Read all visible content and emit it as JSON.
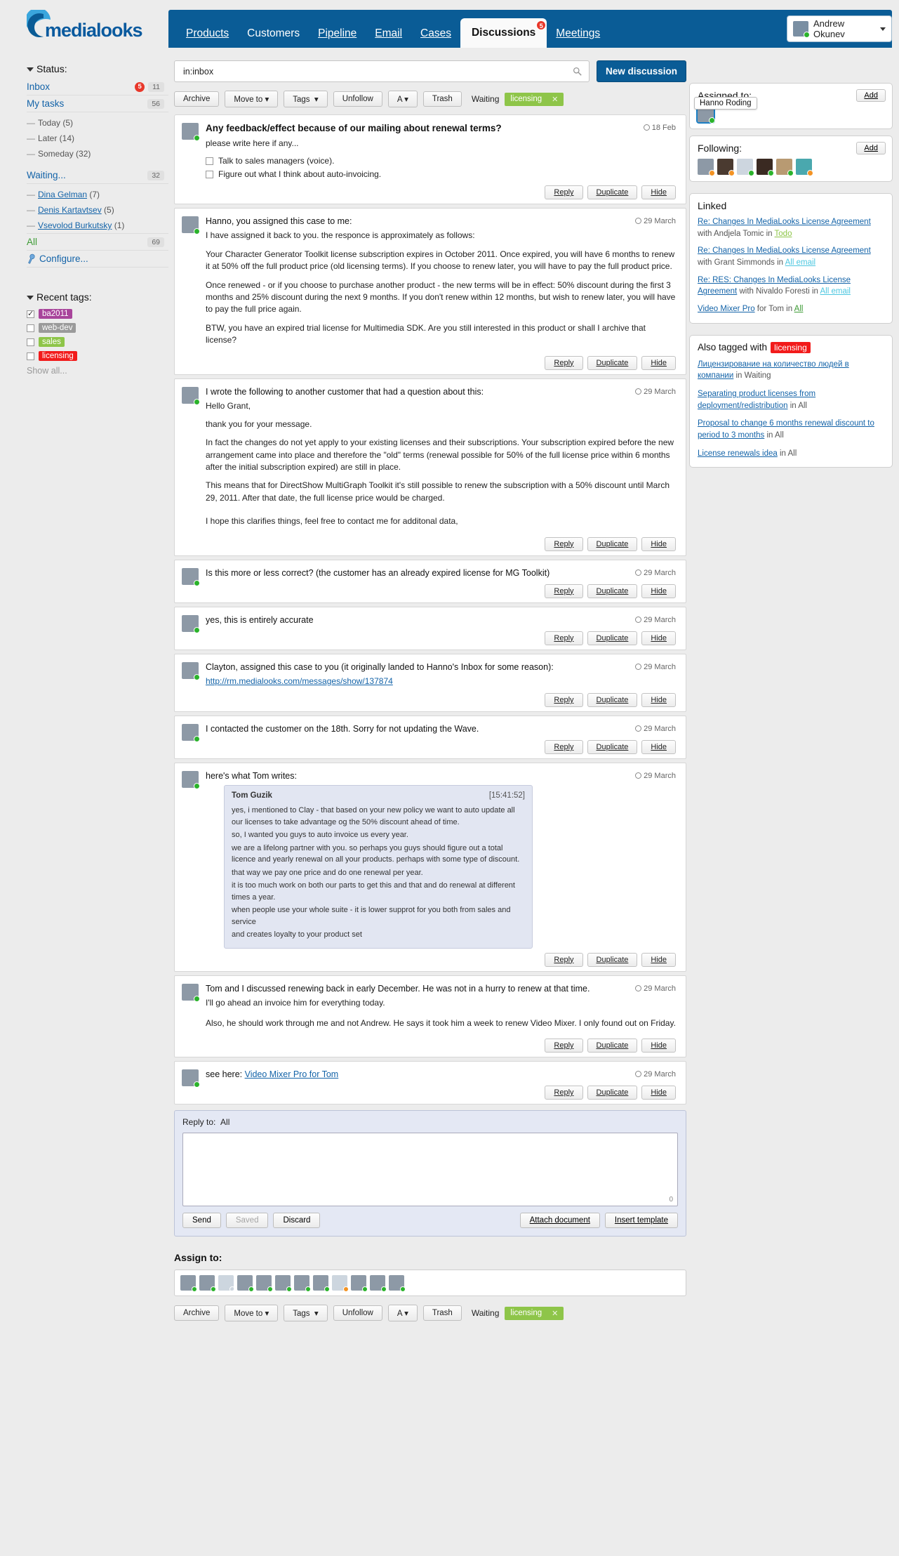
{
  "brand": {
    "name": "medialooks",
    "accent": "#0a5c96"
  },
  "nav": {
    "items": [
      {
        "label": "Products",
        "active": false,
        "badge": null
      },
      {
        "label": "Customers",
        "active": false,
        "badge": null
      },
      {
        "label": "Pipeline",
        "active": false,
        "badge": null
      },
      {
        "label": "Email",
        "active": false,
        "badge": null
      },
      {
        "label": "Cases",
        "active": false,
        "badge": null
      },
      {
        "label": "Discussions",
        "active": true,
        "badge": "5"
      },
      {
        "label": "Meetings",
        "active": false,
        "badge": null
      }
    ]
  },
  "user": {
    "name": "Andrew Okunev"
  },
  "sidebar": {
    "status_header": "Status:",
    "status_items": [
      {
        "label": "Inbox",
        "red": "5",
        "count": "11"
      },
      {
        "label": "My tasks",
        "red": null,
        "count": "56"
      }
    ],
    "task_subitems": [
      {
        "label": "Today (5)"
      },
      {
        "label": "Later (14)"
      },
      {
        "label": "Someday (32)"
      }
    ],
    "waiting": {
      "label": "Waiting...",
      "count": "32"
    },
    "waiting_subitems": [
      {
        "name": "Dina Gelman",
        "count": "(7)"
      },
      {
        "name": "Denis Kartavtsev",
        "count": "(5)"
      },
      {
        "name": "Vsevolod Burkutsky",
        "count": "(1)"
      }
    ],
    "all": {
      "label": "All",
      "count": "69"
    },
    "configure": "Configure...",
    "tags_header": "Recent tags:",
    "tags": [
      {
        "label": "ba2011",
        "color": "#a8449b",
        "checked": true
      },
      {
        "label": "web-dev",
        "color": "#9a9a9a",
        "checked": false
      },
      {
        "label": "sales",
        "color": "#8ec549",
        "checked": false
      },
      {
        "label": "licensing",
        "color": "#f21b1b",
        "checked": false
      }
    ],
    "show_all": "Show all..."
  },
  "search": {
    "value": "in:inbox",
    "placeholder": "Search",
    "new_button": "New discussion"
  },
  "toolbar": {
    "buttons": [
      "Archive",
      "Move to",
      "Tags",
      "Unfollow",
      "A",
      "Trash"
    ],
    "dropdowns": [
      "Move to",
      "Tags",
      "A"
    ],
    "waiting_label": "Waiting",
    "chip": {
      "label": "licensing",
      "color": "#8ec549"
    }
  },
  "messages": [
    {
      "id": "m1",
      "title": "Any feedback/effect because of our mailing about renewal terms?",
      "date": "18 Feb",
      "avatar_status": "on",
      "paras": [
        "please write here if any..."
      ],
      "checkboxes": [
        "Talk to sales managers (voice).",
        "Figure out what I think about auto-invoicing."
      ],
      "actions": [
        "Reply",
        "Duplicate",
        "Hide"
      ]
    },
    {
      "id": "m2",
      "head": "Hanno, you assigned this case to me:",
      "date": "29 March",
      "avatar_status": "on",
      "paras": [
        "I have assigned it back to you. the responce is approximately as follows:",
        "Your Character Generator Toolkit license subscription expires in October 2011. Once expired, you will have 6 months to renew it at 50% off the full product price (old licensing terms). If you choose to renew later, you will have to pay the full product price.",
        "Once renewed - or if you choose to purchase another product - the new terms will be in effect: 50% discount during the first 3 months and 25% discount during the next 9 months. If you don't renew within 12 months, but wish to renew later, you will have to pay the full price again.",
        "BTW, you have an expired trial license for Multimedia SDK. Are you still interested in this product or shall I archive that license?"
      ],
      "actions": [
        "Reply",
        "Duplicate",
        "Hide"
      ]
    },
    {
      "id": "m3",
      "head": "I wrote the following to another customer that had a question about this:",
      "date": "29 March",
      "avatar_status": "on",
      "paras": [
        "Hello Grant,",
        "thank you for your message.",
        "In fact the changes do not yet apply to your existing licenses and their subscriptions. Your subscription expired before the new arrangement came into place and therefore the \"old\" terms (renewal possible for 50% of the full license price within 6 months after the initial subscription expired) are still in place.",
        "This means that for DirectShow MultiGraph Toolkit it's still possible to renew the subscription with a 50% discount until March 29, 2011. After that date, the full license price would be charged.",
        "I hope this clarifies things, feel free to contact me for additonal data,"
      ],
      "actions": [
        "Reply",
        "Duplicate",
        "Hide"
      ]
    },
    {
      "id": "m4",
      "head": "Is this more or less correct? (the customer has an already expired license for MG Toolkit)",
      "date": "29 March",
      "avatar_status": "on",
      "paras": [],
      "actions": [
        "Reply",
        "Duplicate",
        "Hide"
      ]
    },
    {
      "id": "m5",
      "head": "yes, this is entirely accurate",
      "date": "29 March",
      "avatar_status": "on",
      "paras": [],
      "actions": [
        "Reply",
        "Duplicate",
        "Hide"
      ]
    },
    {
      "id": "m6",
      "head": "Clayton, assigned this case to you (it originally landed to Hanno's Inbox for some reason):",
      "date": "29 March",
      "avatar_status": "on",
      "link": "http://rm.medialooks.com/messages/show/137874",
      "paras": [],
      "actions": [
        "Reply",
        "Duplicate",
        "Hide"
      ]
    },
    {
      "id": "m7",
      "head": "I contacted the customer on the 18th.  Sorry for not updating the Wave.",
      "date": "29 March",
      "avatar_status": "on",
      "paras": [],
      "actions": [
        "Reply",
        "Duplicate",
        "Hide"
      ]
    },
    {
      "id": "m8",
      "head": "here's what Tom writes:",
      "date": "29 March",
      "avatar_status": "on",
      "quote": {
        "author": "Tom Guzik",
        "time": "[15:41:52]",
        "lines": [
          "yes, i mentioned to Clay - that based on your new policy we want to auto update all our licenses to take advantage og the 50% discount ahead of time.",
          "so, I wanted you guys to auto invoice us every year.",
          "we are a lifelong partner with you. so perhaps you guys should figure out a total licence and yearly renewal on all your products. perhaps with some type of discount.",
          "that way we pay one price and do one renewal per year.",
          "it is too much work on both our parts to get this and that and do renewal at different times a year.",
          "when people use your whole suite - it is lower supprot for you both from sales and service",
          "and creates loyalty to your product set"
        ]
      },
      "paras": [],
      "actions": [
        "Reply",
        "Duplicate",
        "Hide"
      ]
    },
    {
      "id": "m9",
      "head": "Tom and I discussed renewing back in early December.  He was not in a hurry to renew at that time.",
      "date": "29 March",
      "avatar_status": "on",
      "paras": [
        "I'll go ahead an invoice him for everything today.",
        "Also, he should work through me and not Andrew.  He says it took him a week to renew Video Mixer. I only found out on Friday."
      ],
      "actions": [
        "Reply",
        "Duplicate",
        "Hide"
      ]
    },
    {
      "id": "m10",
      "head_prefix": "see here: ",
      "head_link": "Video Mixer Pro for Tom",
      "date": "29 March",
      "avatar_status": "on",
      "paras": [],
      "actions": [
        "Reply",
        "Duplicate",
        "Hide"
      ]
    }
  ],
  "reply": {
    "to_label": "Reply to:",
    "to_value": "All",
    "char_count": "0",
    "send": "Send",
    "saved": "Saved",
    "discard": "Discard",
    "attach": "Attach document",
    "template": "Insert template"
  },
  "assign": {
    "title": "Assign to:",
    "avatars": [
      {
        "status": "on"
      },
      {
        "status": "on"
      },
      {
        "status": "none"
      },
      {
        "status": "on"
      },
      {
        "status": "on"
      },
      {
        "status": "on"
      },
      {
        "status": "on"
      },
      {
        "status": "on"
      },
      {
        "status": "aw"
      },
      {
        "status": "on"
      },
      {
        "status": "on"
      },
      {
        "status": "on"
      }
    ]
  },
  "right": {
    "assigned": {
      "title": "Assigned to:",
      "add": "Add",
      "tooltip": "Hanno Roding"
    },
    "following": {
      "title": "Following:",
      "add": "Add",
      "avatars": [
        {
          "status": "aw"
        },
        {
          "status": "aw"
        },
        {
          "status": "on"
        },
        {
          "status": "on"
        },
        {
          "status": "on"
        },
        {
          "status": "aw"
        }
      ]
    },
    "linked": {
      "title": "Linked",
      "items": [
        {
          "link": "Re: Changes In MediaLooks License Agreement",
          "mid": " with Andjela Tomic in ",
          "tail": "Todo",
          "tail_class": "todo"
        },
        {
          "link": "Re: Changes In MediaLooks License Agreement",
          "mid": " with Grant Simmonds in ",
          "tail": "All email",
          "tail_class": "allemail"
        },
        {
          "link": "Re: RES: Changes In MediaLooks License Agreement",
          "mid": " with Nivaldo Foresti in ",
          "tail": "All email",
          "tail_class": "allemail"
        },
        {
          "link": "Video Mixer Pro",
          "mid": " for Tom in ",
          "tail": "All",
          "tail_class": "allg"
        }
      ]
    },
    "tagged": {
      "title_prefix": "Also tagged with",
      "tag": "licensing",
      "items": [
        {
          "link": "Лицензирование на количество людей в компании",
          "tail": " in Waiting"
        },
        {
          "link": "Separating product licenses from deployment/redistribution",
          "tail": " in All"
        },
        {
          "link": "Proposal to change 6 months renewal discount to period to 3 months",
          "tail": " in All"
        },
        {
          "link": "License renewals idea",
          "tail": " in All"
        }
      ]
    }
  }
}
